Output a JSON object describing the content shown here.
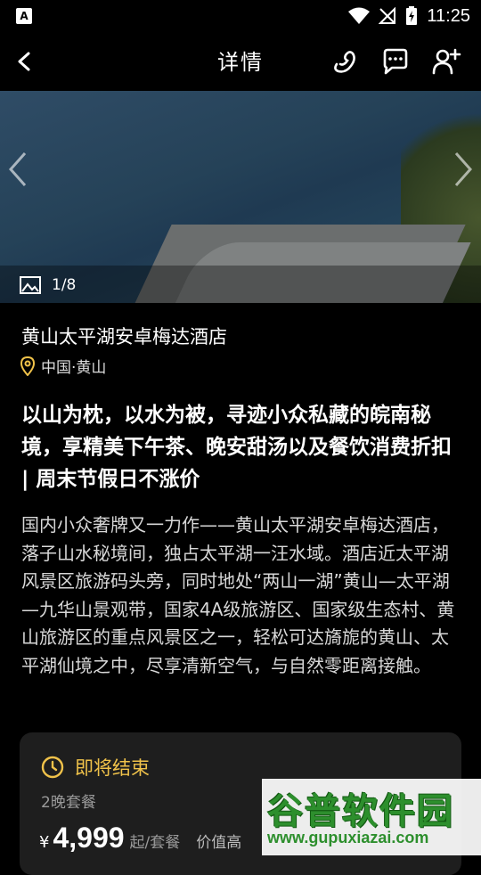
{
  "status_bar": {
    "time": "11:25"
  },
  "header": {
    "title": "详情"
  },
  "gallery": {
    "counter": "1/8"
  },
  "hotel": {
    "name": "黄山太平湖安卓梅达酒店",
    "location": "中国·黄山"
  },
  "headline": "以山为枕，以水为被，寻迹小众私藏的皖南秘境，享精美下午茶、晚安甜汤以及餐饮消费折扣 | 周末节假日不涨价",
  "description": "国内小众奢牌又一力作——黄山太平湖安卓梅达酒店，落子山水秘境间，独占太平湖一汪水域。酒店近太平湖风景区旅游码头旁，同时地处“两山一湖”黄山—太平湖—九华山景观带，国家4A级旅游区、国家级生态村、黄山旅游区的重点风景区之一，轻松可达旖旎的黄山、太平湖仙境之中，尽享清新空气，与自然零距离接触。",
  "offer": {
    "status": "即将结束",
    "package": "2晚套餐",
    "currency": "¥",
    "price": "4,999",
    "unit": "起/套餐",
    "note": "价值高"
  },
  "watermark": {
    "title": "谷普软件园",
    "url": "www.gupuxiazai.com"
  },
  "colors": {
    "accent": "#f0c24a",
    "background": "#000000",
    "card": "#1e1e1e"
  }
}
